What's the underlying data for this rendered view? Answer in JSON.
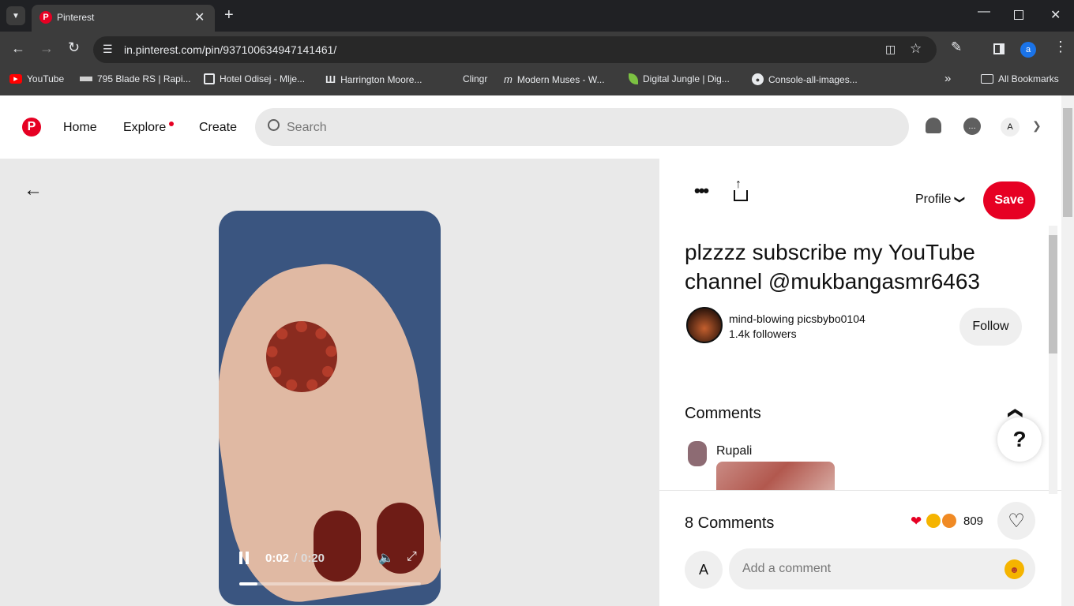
{
  "browser": {
    "tab_title": "Pinterest",
    "url": "in.pinterest.com/pin/937100634947141461/",
    "profile_initial": "a",
    "bookmarks": [
      {
        "label": "YouTube",
        "icon": "youtube-icon"
      },
      {
        "label": "795 Blade RS | Rapi...",
        "icon": "blade-icon"
      },
      {
        "label": "Hotel Odisej - Mlje...",
        "icon": "hotel-icon"
      },
      {
        "label": "Harrington Moore...",
        "icon": "hm-icon"
      },
      {
        "label": "Clingr",
        "icon": "clingr-icon"
      },
      {
        "label": "Modern Muses - W...",
        "icon": "muses-icon"
      },
      {
        "label": "Digital Jungle | Dig...",
        "icon": "leaf-icon"
      },
      {
        "label": "Console-all-images...",
        "icon": "github-icon"
      }
    ],
    "all_bookmarks": "All Bookmarks"
  },
  "header": {
    "home": "Home",
    "explore": "Explore",
    "create": "Create",
    "search_placeholder": "Search",
    "avatar_initial": "A"
  },
  "pin": {
    "title": "plzzzz subscribe my YouTube channel @mukbangasmr6463",
    "profile_label": "Profile",
    "save_label": "Save",
    "creator_name": "mind-blowing picsbybo0104",
    "followers": "1.4k followers",
    "follow_label": "Follow",
    "comments_heading": "Comments",
    "commenter_name": "Rupali",
    "comment_count": "8 Comments",
    "reaction_count": "809",
    "comment_placeholder": "Add a comment",
    "comment_avatar": "A",
    "help_label": "?"
  },
  "video": {
    "current_time": "0:02",
    "separator": " / ",
    "duration": "0:20",
    "progress": 0.1
  },
  "colors": {
    "pinterest_red": "#e60023",
    "chrome_dark": "#202124",
    "chrome_mid": "#3c3c3c"
  }
}
